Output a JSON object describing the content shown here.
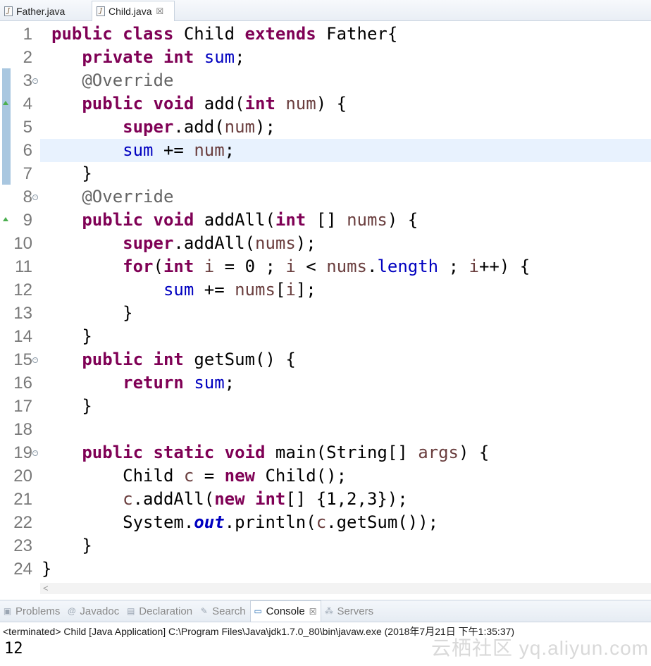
{
  "editor_tabs": [
    {
      "label": "Father.java",
      "active": false
    },
    {
      "label": "Child.java",
      "active": true,
      "close": "☒"
    }
  ],
  "code_lines": [
    [
      {
        "t": "public class ",
        "c": "kw"
      },
      {
        "t": "Child "
      },
      {
        "t": "extends ",
        "c": "kw"
      },
      {
        "t": "Father{"
      }
    ],
    [
      {
        "t": "   "
      },
      {
        "t": "private int ",
        "c": "kw"
      },
      {
        "t": "sum",
        "c": "fld"
      },
      {
        "t": ";"
      }
    ],
    [
      {
        "t": "   "
      },
      {
        "t": "@Override",
        "c": "ann"
      }
    ],
    [
      {
        "t": "   "
      },
      {
        "t": "public void ",
        "c": "kw"
      },
      {
        "t": "add("
      },
      {
        "t": "int ",
        "c": "kw"
      },
      {
        "t": "num",
        "c": "var"
      },
      {
        "t": ") {"
      }
    ],
    [
      {
        "t": "       "
      },
      {
        "t": "super",
        "c": "kw"
      },
      {
        "t": ".add("
      },
      {
        "t": "num",
        "c": "var"
      },
      {
        "t": ");"
      }
    ],
    [
      {
        "t": "       "
      },
      {
        "t": "sum",
        "c": "fld"
      },
      {
        "t": " += "
      },
      {
        "t": "num",
        "c": "var"
      },
      {
        "t": ";"
      }
    ],
    [
      {
        "t": "   }"
      }
    ],
    [
      {
        "t": "   "
      },
      {
        "t": "@Override",
        "c": "ann"
      }
    ],
    [
      {
        "t": "   "
      },
      {
        "t": "public void ",
        "c": "kw"
      },
      {
        "t": "addAll("
      },
      {
        "t": "int ",
        "c": "kw"
      },
      {
        "t": "[] "
      },
      {
        "t": "nums",
        "c": "var"
      },
      {
        "t": ") {"
      }
    ],
    [
      {
        "t": "       "
      },
      {
        "t": "super",
        "c": "kw"
      },
      {
        "t": ".addAll("
      },
      {
        "t": "nums",
        "c": "var"
      },
      {
        "t": ");"
      }
    ],
    [
      {
        "t": "       "
      },
      {
        "t": "for",
        "c": "kw"
      },
      {
        "t": "("
      },
      {
        "t": "int ",
        "c": "kw"
      },
      {
        "t": "i",
        "c": "var"
      },
      {
        "t": " = 0 ; "
      },
      {
        "t": "i",
        "c": "var"
      },
      {
        "t": " < "
      },
      {
        "t": "nums",
        "c": "var"
      },
      {
        "t": "."
      },
      {
        "t": "length",
        "c": "fld"
      },
      {
        "t": " ; "
      },
      {
        "t": "i",
        "c": "var"
      },
      {
        "t": "++) {"
      }
    ],
    [
      {
        "t": "           "
      },
      {
        "t": "sum",
        "c": "fld"
      },
      {
        "t": " += "
      },
      {
        "t": "nums",
        "c": "var"
      },
      {
        "t": "["
      },
      {
        "t": "i",
        "c": "var"
      },
      {
        "t": "];"
      }
    ],
    [
      {
        "t": "       }"
      }
    ],
    [
      {
        "t": "   }"
      }
    ],
    [
      {
        "t": "   "
      },
      {
        "t": "public int ",
        "c": "kw"
      },
      {
        "t": "getSum() {"
      }
    ],
    [
      {
        "t": "       "
      },
      {
        "t": "return ",
        "c": "kw"
      },
      {
        "t": "sum",
        "c": "fld"
      },
      {
        "t": ";"
      }
    ],
    [
      {
        "t": "   }"
      }
    ],
    [],
    [
      {
        "t": "   "
      },
      {
        "t": "public static void ",
        "c": "kw"
      },
      {
        "t": "main(String[] "
      },
      {
        "t": "args",
        "c": "var"
      },
      {
        "t": ") {"
      }
    ],
    [
      {
        "t": "       Child "
      },
      {
        "t": "c",
        "c": "var"
      },
      {
        "t": " = "
      },
      {
        "t": "new ",
        "c": "kw"
      },
      {
        "t": "Child();"
      }
    ],
    [
      {
        "t": "       "
      },
      {
        "t": "c",
        "c": "var"
      },
      {
        "t": ".addAll("
      },
      {
        "t": "new ",
        "c": "kw"
      },
      {
        "t": "int",
        "c": "kw"
      },
      {
        "t": "[] {1,2,3});"
      }
    ],
    [
      {
        "t": "       System."
      },
      {
        "t": "out",
        "c": "sfld"
      },
      {
        "t": ".println("
      },
      {
        "t": "c",
        "c": "var"
      },
      {
        "t": ".getSum());"
      }
    ],
    [
      {
        "t": "   }"
      }
    ],
    [
      {
        "t": "}"
      }
    ]
  ],
  "fold_markers": [
    3,
    8,
    15,
    19
  ],
  "override_markers": [
    4,
    9
  ],
  "current_line": 6,
  "view_tabs": [
    {
      "label": "Problems",
      "icon": "problems-icon",
      "active": false
    },
    {
      "label": "Javadoc",
      "icon": "javadoc-icon",
      "active": false
    },
    {
      "label": "Declaration",
      "icon": "declaration-icon",
      "active": false
    },
    {
      "label": "Search",
      "icon": "search-icon",
      "active": false
    },
    {
      "label": "Console",
      "icon": "console-icon",
      "active": true,
      "close": "☒"
    },
    {
      "label": "Servers",
      "icon": "servers-icon",
      "active": false
    }
  ],
  "console": {
    "status": "<terminated> Child [Java Application] C:\\Program Files\\Java\\jdk1.7.0_80\\bin\\javaw.exe (2018年7月21日 下午1:35:37)",
    "output": "12"
  },
  "watermark": "云栖社区 yq.aliyun.com"
}
